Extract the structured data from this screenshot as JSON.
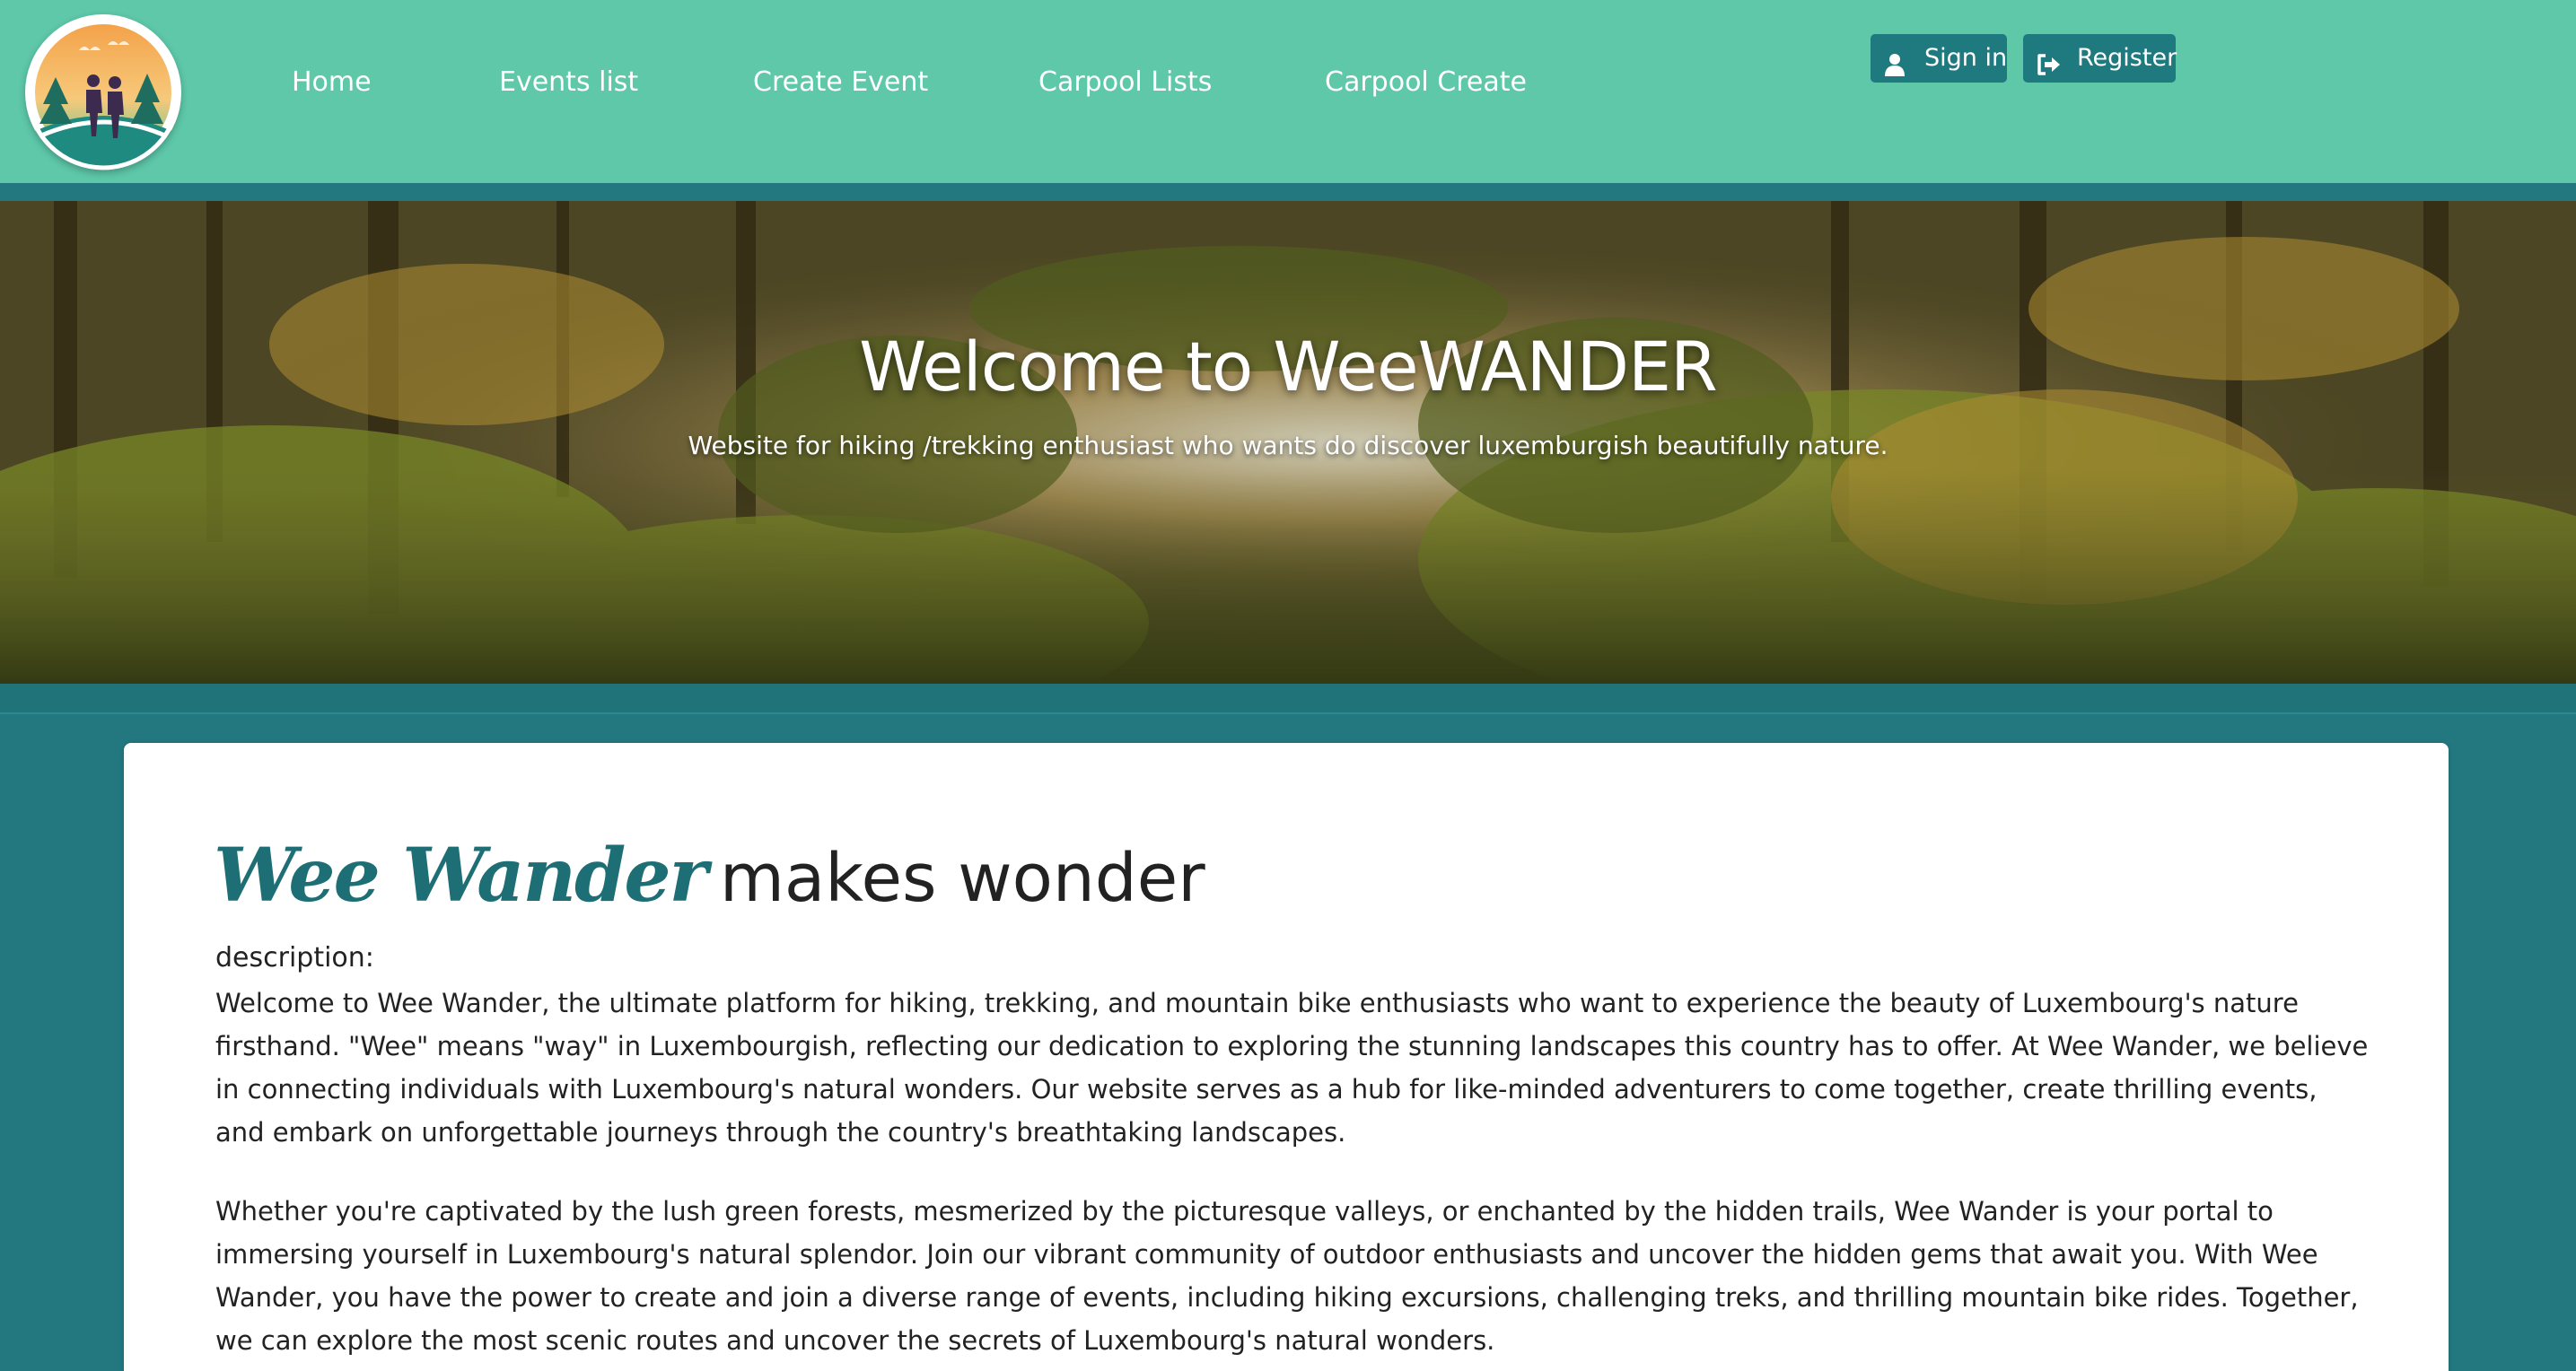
{
  "nav": {
    "links": [
      "Home",
      "Events list",
      "Create Event",
      "Carpool Lists",
      "Carpool Create"
    ],
    "sign_in": "Sign in",
    "register": "Register"
  },
  "hero": {
    "title": "Welcome to WeeWANDER",
    "subtitle": "Website for hiking /trekking enthusiast who wants do discover luxemburgish beautifully nature."
  },
  "content": {
    "brand": "Wee Wander",
    "heading_rest": "makes wonder",
    "description_label": "description:",
    "paragraphs": [
      "Welcome to Wee Wander, the ultimate platform for hiking, trekking, and mountain bike enthusiasts who want to experience the beauty of Luxembourg's nature firsthand. \"Wee\" means \"way\" in Luxembourgish, reflecting our dedication to exploring the stunning landscapes this country has to offer. At Wee Wander, we believe in connecting individuals with Luxembourg's natural wonders. Our website serves as a hub for like-minded adventurers to come together, create thrilling events, and embark on unforgettable journeys through the country's breathtaking landscapes.",
      "Whether you're captivated by the lush green forests, mesmerized by the picturesque valleys, or enchanted by the hidden trails, Wee Wander is your portal to immersing yourself in Luxembourg's natural splendor. Join our vibrant community of outdoor enthusiasts and uncover the hidden gems that await you. With Wee Wander, you have the power to create and join a diverse range of events, including hiking excursions, challenging treks, and thrilling mountain bike rides. Together, we can explore the most scenic routes and uncover the secrets of Luxembourg's natural wonders."
    ]
  },
  "colors": {
    "navbar": "#5ec8a9",
    "accent": "#1f7a80",
    "page_background": "#23787f"
  },
  "icons": {
    "sign_in": "user-icon",
    "register": "sign-out-icon"
  }
}
